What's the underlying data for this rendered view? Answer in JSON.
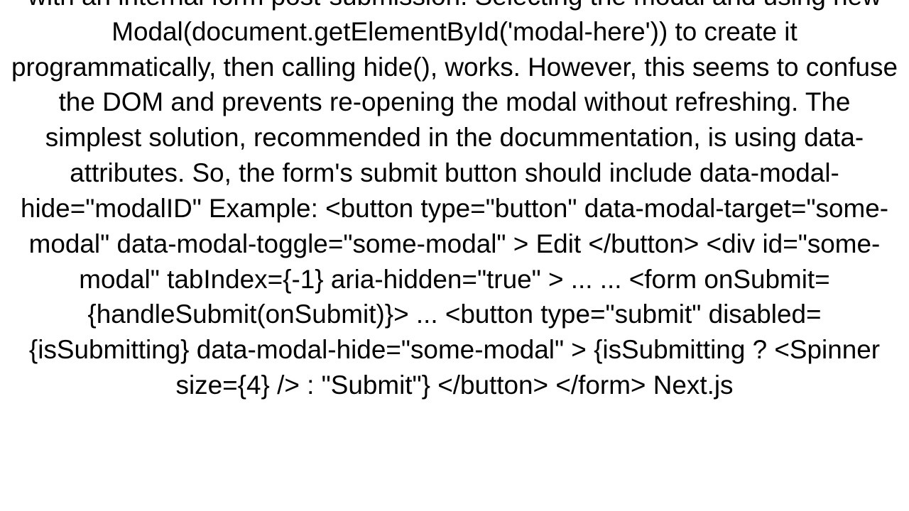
{
  "article": {
    "body": "with an internal form post-submission. Selecting the modal and using new Modal(document.getElementById('modal-here')) to create it programmatically, then calling hide(), works. However, this seems to confuse the DOM and prevents re-opening the modal without refreshing. The simplest solution, recommended in the docummentation, is using data-attributes. So, the form's submit button should include data-modal-hide=\"modalID\" Example: <button   type=\"button\"   data-modal-target=\"some-modal\"   data-modal-toggle=\"some-modal\" >   Edit </button>  <div   id=\"some-modal\"   tabIndex={-1}   aria-hidden=\"true\" >   ...   ...   <form onSubmit={handleSubmit(onSubmit)}>     ...     <button       type=\"submit\"       disabled={isSubmitting}       data-modal-hide=\"some-modal\"     >       {isSubmitting ? <Spinner size={4} /> : \"Submit\"}     </button>   </form>   Next.js"
  }
}
